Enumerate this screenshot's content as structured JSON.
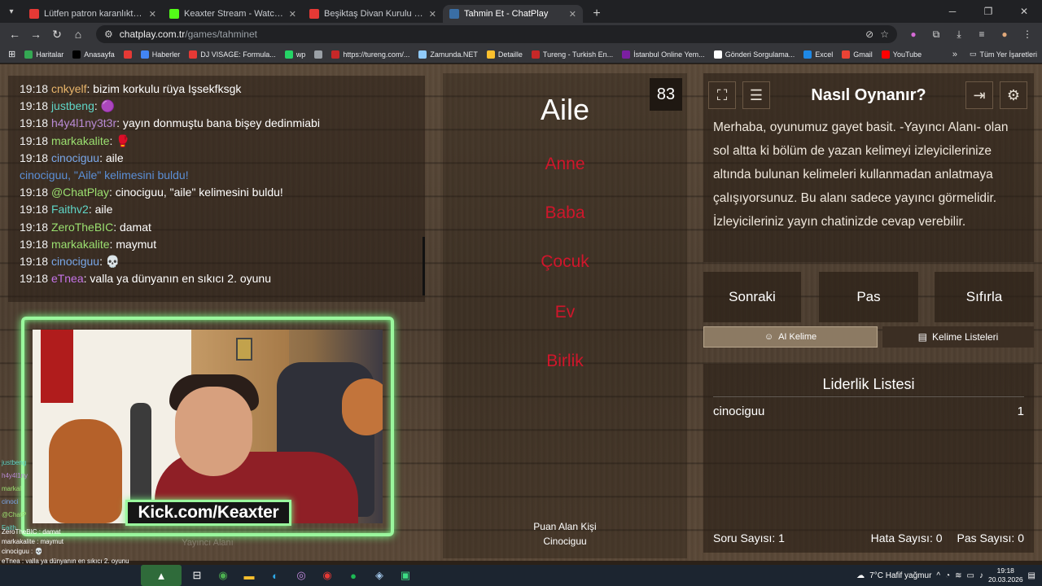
{
  "browser": {
    "tabs": [
      {
        "title": "Lütfen patron karanlıktan korkuyor",
        "fav": "#e53935",
        "active": false
      },
      {
        "title": "Keaxter Stream - Watch Live on Kick",
        "fav": "#53fc18",
        "active": false
      },
      {
        "title": "Beşiktaş Divan Kurulu Kavga - Canlı",
        "fav": "#e53935",
        "active": false
      },
      {
        "title": "Tahmin Et - ChatPlay",
        "fav": "#3a6ea5",
        "active": true
      }
    ],
    "url_host": "chatplay.com.tr",
    "url_path": "/games/tahminet",
    "bookmarks": [
      {
        "label": "Haritalar",
        "color": "#34a853"
      },
      {
        "label": "Anasayfa",
        "color": "#000000"
      },
      {
        "label": "",
        "color": "#e53935"
      },
      {
        "label": "Haberler",
        "color": "#4285f4"
      },
      {
        "label": "DJ VISAGE: Formula...",
        "color": "#e53935"
      },
      {
        "label": "wp",
        "color": "#25d366"
      },
      {
        "label": "",
        "color": "#9aa0a6"
      },
      {
        "label": "https://tureng.com/...",
        "color": "#c62828"
      },
      {
        "label": "Zamunda.NET",
        "color": "#90caf9"
      },
      {
        "label": "Detaille",
        "color": "#fbc02d"
      },
      {
        "label": "Tureng - Turkish En...",
        "color": "#c62828"
      },
      {
        "label": "İstanbul Online Yem...",
        "color": "#7b1fa2"
      },
      {
        "label": "Gönderi Sorgulama...",
        "color": "#ffffff"
      },
      {
        "label": "Excel",
        "color": "#1e88e5"
      },
      {
        "label": "Gmail",
        "color": "#ea4335"
      },
      {
        "label": "YouTube",
        "color": "#ff0000"
      }
    ],
    "all_bookmarks": "Tüm Yer İşaretleri"
  },
  "chat": {
    "messages": [
      {
        "time": "19:18",
        "user": "cnkyelf",
        "color": "#e8b56a",
        "text": "bizim korkulu rüya Işsekfksgk"
      },
      {
        "time": "19:18",
        "user": "justbeng",
        "color": "#5fd6c7",
        "text": "🟣"
      },
      {
        "time": "19:18",
        "user": "h4y4l1ny3t3r",
        "color": "#b98bd6",
        "text": "yayın donmuştu bana bişey dedinmiabi"
      },
      {
        "time": "19:18",
        "user": "markakalite",
        "color": "#9be070",
        "text": "🥊"
      },
      {
        "time": "19:18",
        "user": "cinociguu",
        "color": "#79a7e8",
        "text": "aile"
      },
      {
        "system": "cinociguu, \"Aile\" kelimesini buldu!"
      },
      {
        "time": "19:18",
        "user": "@ChatPlay",
        "color": "#9be070",
        "text": "cinociguu, \"aile\" kelimesini buldu!"
      },
      {
        "time": "19:18",
        "user": "Faithv2",
        "color": "#5fd6c7",
        "text": "aile"
      },
      {
        "time": "19:18",
        "user": "ZeroTheBIC",
        "color": "#9be070",
        "text": "damat"
      },
      {
        "time": "19:18",
        "user": "markakalite",
        "color": "#9be070",
        "text": "maymut"
      },
      {
        "time": "19:18",
        "user": "cinociguu",
        "color": "#79a7e8",
        "text": "💀"
      },
      {
        "time": "19:18",
        "user": "eTnea",
        "color": "#c674e8",
        "text": "valla ya dünyanın en sıkıcı 2. oyunu"
      }
    ]
  },
  "webcam": {
    "kick_label": "Kick.com/Keaxter",
    "area_label": "Yayıncı Alanı"
  },
  "mini_chat": [
    "justbeng",
    "h4y4l1ny",
    "markal",
    "cinoci",
    "@ChatP",
    "Faith"
  ],
  "overlay_chat": [
    "ZeroTheBIC : damat",
    "markakalite : maymut",
    "cinociguu : 💀",
    "eTnea : valla ya dünyanın en sıkıcı 2. oyunu"
  ],
  "game": {
    "counter": "83",
    "word": "Aile",
    "taboo": [
      "Anne",
      "Baba",
      "Çocuk",
      "Ev",
      "Birlik"
    ],
    "scorer_label": "Puan Alan Kişi",
    "scorer_name": "Cinociguu"
  },
  "help": {
    "title": "Nasıl Oynanır?",
    "text": "Merhaba, oyunumuz gayet basit. -Yayıncı Alanı- olan sol altta ki bölüm de yazan kelimeyi izleyicilerinize altında bulunan kelimeleri kullanmadan anlatmaya çalışıyorsunuz. Bu alanı sadece yayıncı görmelidir. İzleyicileriniz yayın chatinizde cevap verebilir."
  },
  "buttons": {
    "next": "Sonraki",
    "pass": "Pas",
    "reset": "Sıfırla",
    "ai_word": "AI Kelime",
    "word_lists": "Kelime Listeleri"
  },
  "leaderboard": {
    "title": "Liderlik Listesi",
    "rows": [
      {
        "name": "cinociguu",
        "score": "1"
      }
    ],
    "question_count": "Soru Sayısı: 1",
    "error_count": "Hata Sayısı: 0",
    "pass_count": "Pas Sayısı: 0"
  },
  "taskbar": {
    "weather": "7°C  Hafif yağmur",
    "time": "19:18",
    "date": "20.03.2026"
  }
}
